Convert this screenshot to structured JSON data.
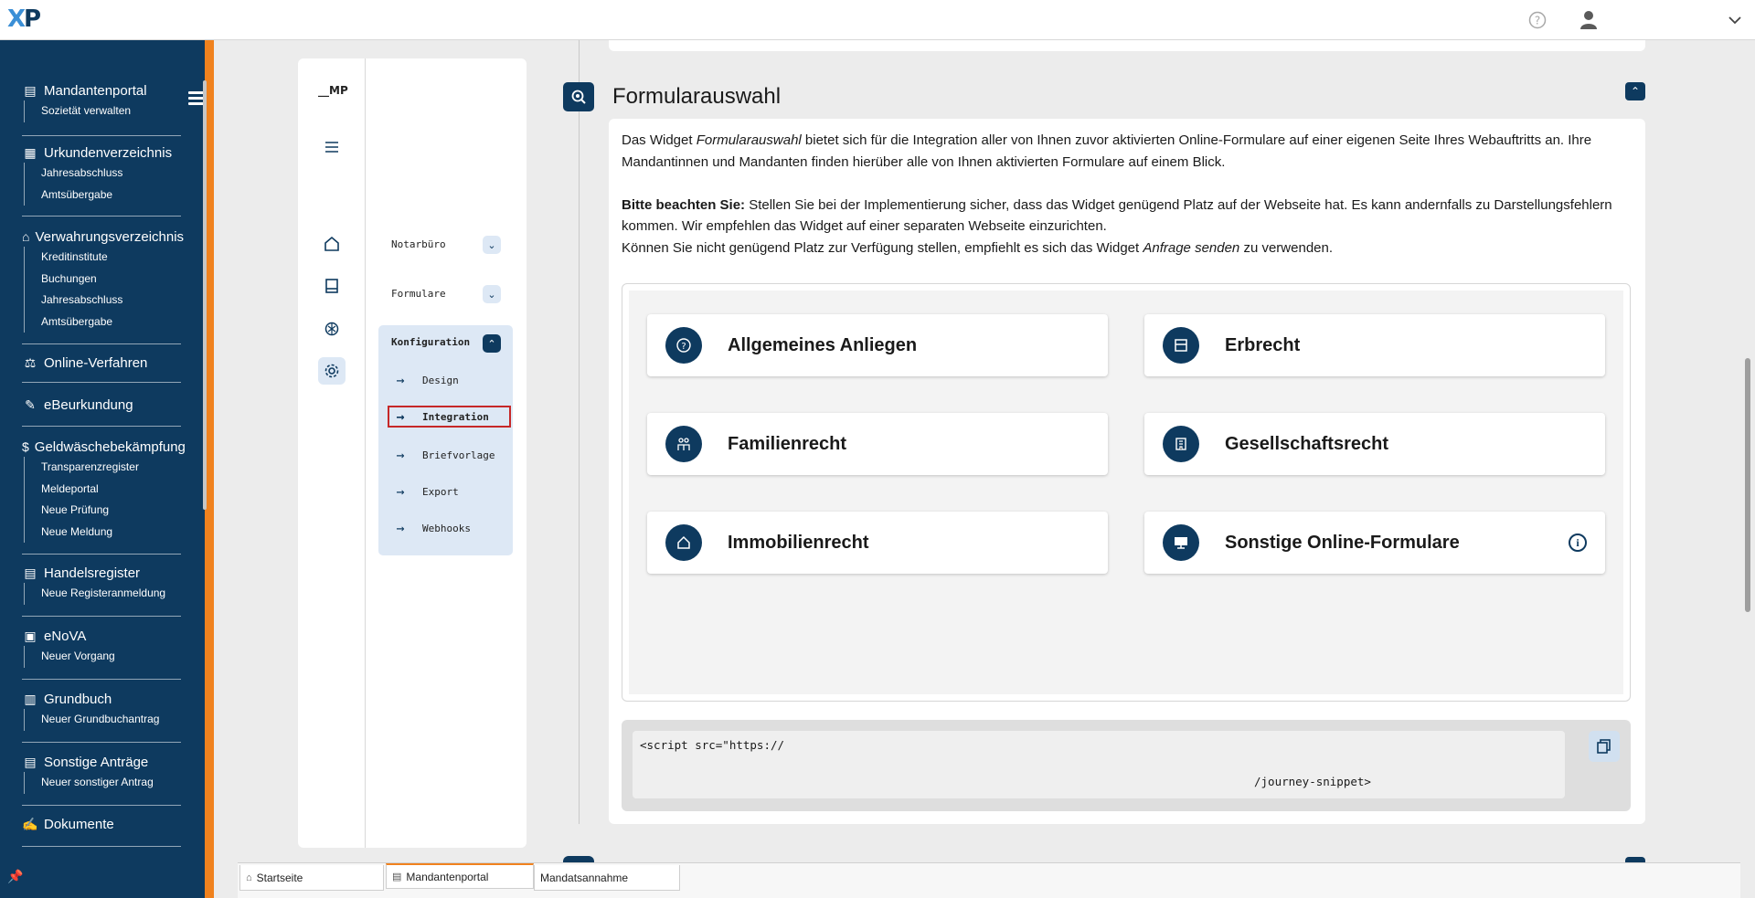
{
  "app": {
    "logo_text": "XP"
  },
  "sidebar": {
    "groups": [
      {
        "label": "Mandantenportal",
        "items": [
          "Sozietät verwalten"
        ]
      },
      {
        "label": "Urkundenverzeichnis",
        "items": [
          "Jahresabschluss",
          "Amtsübergabe"
        ]
      },
      {
        "label": "Verwahrungsverzeichnis",
        "items": [
          "Kreditinstitute",
          "Buchungen",
          "Jahresabschluss",
          "Amtsübergabe"
        ]
      },
      {
        "label": "Online-Verfahren",
        "items": []
      },
      {
        "label": "eBeurkundung",
        "items": []
      },
      {
        "label": "Geldwäschebekämpfung",
        "items": [
          "Transparenzregister",
          "Meldeportal",
          "Neue Prüfung",
          "Neue Meldung"
        ]
      },
      {
        "label": "Handelsregister",
        "items": [
          "Neue Registeranmeldung"
        ]
      },
      {
        "label": "eNoVA",
        "items": [
          "Neuer Vorgang"
        ]
      },
      {
        "label": "Grundbuch",
        "items": [
          "Neuer Grundbuchantrag"
        ]
      },
      {
        "label": "Sonstige Anträge",
        "items": [
          "Neuer sonstiger Antrag"
        ]
      },
      {
        "label": "Dokumente",
        "items": []
      }
    ]
  },
  "phone": {
    "logo": "__MP",
    "nav": {
      "notarbuero": "Notarbüro",
      "formulare": "Formulare",
      "konfiguration": "Konfiguration"
    },
    "sub_items": [
      "Design",
      "Integration",
      "Briefvorlage",
      "Export",
      "Webhooks"
    ],
    "selected_sub": "Integration"
  },
  "section": {
    "title": "Formularauswahl",
    "desc1_pre": "Das Widget ",
    "desc1_em": "Formularauswahl",
    "desc1_post": " bietet sich für die Integration aller von Ihnen zuvor aktivierten Online-Formulare auf einer eigenen Seite Ihres Webauftritts an. Ihre Mandantinnen und Mandanten finden hierüber alle von Ihnen aktivierten Formulare auf einem Blick.",
    "note_bold": "Bitte beachten Sie:",
    "note_text": " Stellen Sie bei der Implementierung sicher, dass das Widget genügend Platz auf der Webseite hat. Es kann andernfalls zu Darstellungsfehlern kommen. Wir empfehlen das Widget auf einer separaten Webseite einzurichten.",
    "note2_pre": "Können Sie nicht genügend Platz zur Verfügung stellen, empfiehlt es sich das Widget ",
    "note2_em": "Anfrage senden",
    "note2_post": " zu verwenden.",
    "tiles": [
      {
        "label": "Allgemeines Anliegen",
        "icon": "question-circle-icon"
      },
      {
        "label": "Erbrecht",
        "icon": "archive-box-icon"
      },
      {
        "label": "Familienrecht",
        "icon": "family-icon"
      },
      {
        "label": "Gesellschaftsrecht",
        "icon": "building-icon"
      },
      {
        "label": "Immobilienrecht",
        "icon": "house-icon"
      },
      {
        "label": "Sonstige Online-Formulare",
        "icon": "monitor-icon"
      }
    ],
    "code_line1": "<script src=\"https://",
    "code_line2": "/journey-snippet>"
  },
  "tabs": [
    {
      "label": "Startseite",
      "icon": "home-icon"
    },
    {
      "label": "Mandantenportal",
      "icon": "portal-icon"
    },
    {
      "label": "Mandatsannahme",
      "icon": ""
    }
  ],
  "colors": {
    "primary": "#0e3a5f",
    "accent": "#f0821e",
    "highlight": "#dde8f5",
    "selection_border": "#c62828"
  }
}
